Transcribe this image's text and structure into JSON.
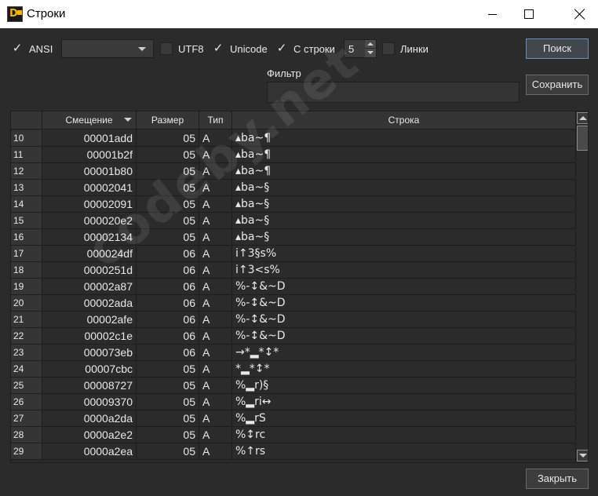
{
  "window": {
    "title": "Строки",
    "icon": "app-logo-icon"
  },
  "toolbar": {
    "ansi": {
      "label": "ANSI",
      "checked": true
    },
    "encoding_combo": {
      "value": ""
    },
    "utf8": {
      "label": "UTF8",
      "checked": false
    },
    "unicode": {
      "label": "Unicode",
      "checked": true
    },
    "from_line": {
      "label": "С строки",
      "checked": true
    },
    "min_length": "5",
    "links": {
      "label": "Линки",
      "checked": false
    },
    "check_glyph": "✓",
    "search_label": "Поиск",
    "save_label": "Сохранить"
  },
  "filter": {
    "label": "Фильтр",
    "value": ""
  },
  "table": {
    "columns": [
      "Смещение",
      "Размер",
      "Тип",
      "Строка"
    ],
    "rows": [
      {
        "n": "10",
        "offset": "00001add",
        "size": "05",
        "type": "A",
        "str": "▴ba~¶"
      },
      {
        "n": "11",
        "offset": "00001b2f",
        "size": "05",
        "type": "A",
        "str": "▴ba~¶"
      },
      {
        "n": "12",
        "offset": "00001b80",
        "size": "05",
        "type": "A",
        "str": "▴ba~¶"
      },
      {
        "n": "13",
        "offset": "00002041",
        "size": "05",
        "type": "A",
        "str": "▴ba~§"
      },
      {
        "n": "14",
        "offset": "00002091",
        "size": "05",
        "type": "A",
        "str": "▴ba~§"
      },
      {
        "n": "15",
        "offset": "000020e2",
        "size": "05",
        "type": "A",
        "str": "▴ba~§"
      },
      {
        "n": "16",
        "offset": "00002134",
        "size": "05",
        "type": "A",
        "str": "▴ba~§"
      },
      {
        "n": "17",
        "offset": "000024df",
        "size": "06",
        "type": "A",
        "str": "i↑3§s%"
      },
      {
        "n": "18",
        "offset": "0000251d",
        "size": "06",
        "type": "A",
        "str": "i↑3<s%"
      },
      {
        "n": "19",
        "offset": "00002a87",
        "size": "06",
        "type": "A",
        "str": "%-↕&~D"
      },
      {
        "n": "20",
        "offset": "00002ada",
        "size": "06",
        "type": "A",
        "str": "%-↕&~D"
      },
      {
        "n": "21",
        "offset": "00002afe",
        "size": "06",
        "type": "A",
        "str": "%-↕&~D"
      },
      {
        "n": "22",
        "offset": "00002c1e",
        "size": "06",
        "type": "A",
        "str": "%-↕&~D"
      },
      {
        "n": "23",
        "offset": "000073eb",
        "size": "06",
        "type": "A",
        "str": "→*▂*↕*"
      },
      {
        "n": "24",
        "offset": "00007cbc",
        "size": "05",
        "type": "A",
        "str": "*▂*↕*"
      },
      {
        "n": "25",
        "offset": "00008727",
        "size": "05",
        "type": "A",
        "str": "%▂r)§"
      },
      {
        "n": "26",
        "offset": "00009370",
        "size": "05",
        "type": "A",
        "str": "%▂ri↔"
      },
      {
        "n": "27",
        "offset": "0000a2da",
        "size": "05",
        "type": "A",
        "str": "%▂rS"
      },
      {
        "n": "28",
        "offset": "0000a2e2",
        "size": "05",
        "type": "A",
        "str": "%↕rc"
      },
      {
        "n": "29",
        "offset": "0000a2ea",
        "size": "05",
        "type": "A",
        "str": "%↑rs"
      }
    ]
  },
  "footer": {
    "close_label": "Закрыть"
  },
  "watermark": "codeby.net"
}
